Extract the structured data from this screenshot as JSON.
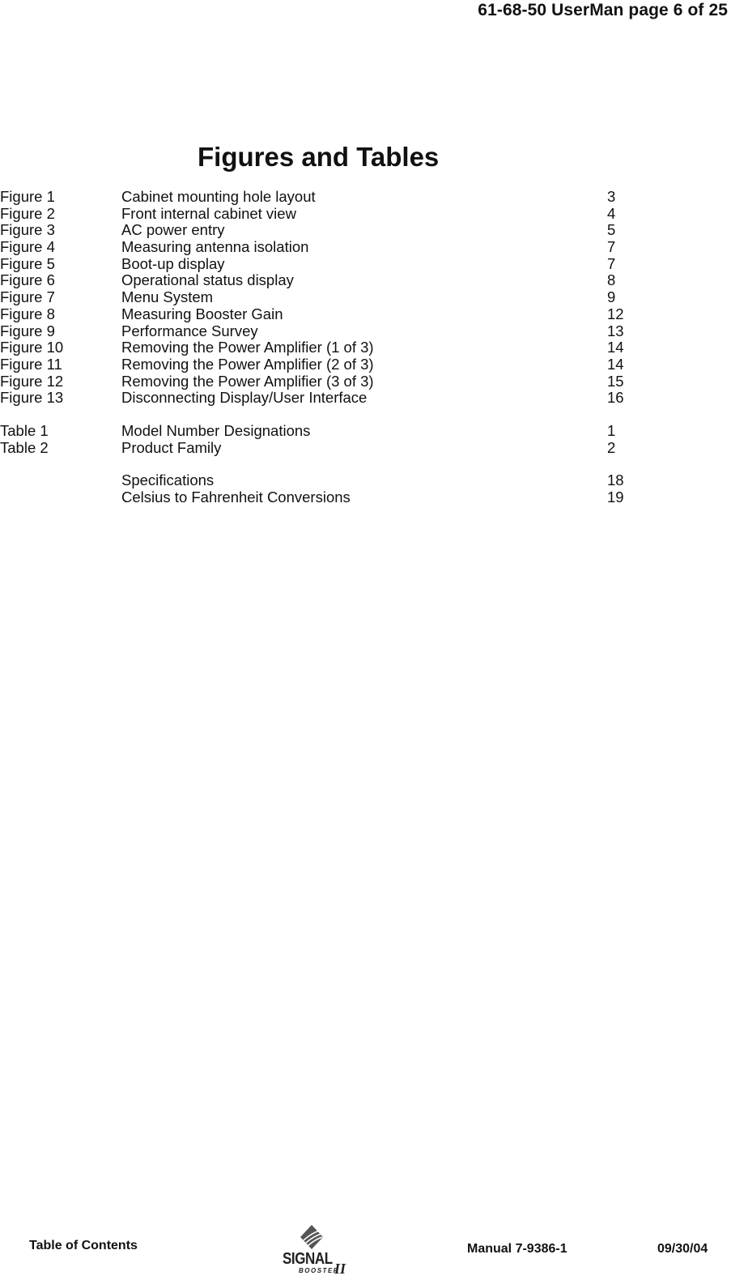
{
  "header": {
    "page_label": "61-68-50 UserMan page 6 of 25"
  },
  "title": "Figures and Tables",
  "figures": [
    {
      "label": "Figure 1",
      "title": "Cabinet mounting hole layout",
      "page": "3"
    },
    {
      "label": "Figure 2",
      "title": "Front internal cabinet view",
      "page": "4"
    },
    {
      "label": "Figure 3",
      "title": "AC power entry",
      "page": "5"
    },
    {
      "label": "Figure 4",
      "title": "Measuring antenna isolation",
      "page": "7"
    },
    {
      "label": "Figure 5",
      "title": "Boot-up display",
      "page": "7"
    },
    {
      "label": "Figure 6",
      "title": "Operational status display",
      "page": "8"
    },
    {
      "label": "Figure 7",
      "title": "Menu System",
      "page": "9"
    },
    {
      "label": "Figure 8",
      "title": "Measuring Booster Gain",
      "page": "12"
    },
    {
      "label": "Figure 9",
      "title": "Performance Survey",
      "page": "13"
    },
    {
      "label": "Figure 10",
      "title": "Removing the Power Amplifier (1 of 3)",
      "page": "14"
    },
    {
      "label": "Figure 11",
      "title": "Removing the Power Amplifier (2 of 3)",
      "page": "14"
    },
    {
      "label": "Figure 12",
      "title": "Removing the Power Amplifier (3 of 3)",
      "page": "15"
    },
    {
      "label": "Figure 13",
      "title": "Disconnecting Display/User Interface",
      "page": "16"
    }
  ],
  "tables": [
    {
      "label": "Table 1",
      "title": "Model Number Designations",
      "page": "1"
    },
    {
      "label": "Table 2",
      "title": "Product Family",
      "page": "2"
    }
  ],
  "other": [
    {
      "label": "",
      "title": "Specifications",
      "page": "18"
    },
    {
      "label": "",
      "title": "Celsius to Fahrenheit Conversions",
      "page": "19"
    }
  ],
  "footer": {
    "section": "Table of Contents",
    "logo": {
      "word": "SIGNAL",
      "sub": "BOOSTER",
      "roman": "II",
      "icon": "signal-booster-logo-icon"
    },
    "manual": "Manual 7-9386-1",
    "date": "09/30/04"
  }
}
